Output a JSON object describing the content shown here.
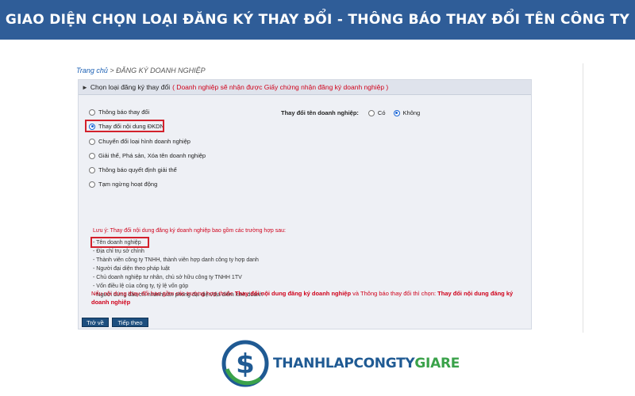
{
  "banner": {
    "title": "GIAO DIỆN CHỌN LOẠI ĐĂNG KÝ THAY ĐỔI - THÔNG BÁO THAY ĐỔI TÊN CÔNG TY"
  },
  "breadcrumb": {
    "home": "Trang chủ",
    "separator": ">",
    "current": "ĐĂNG KÝ DOANH NGHIỆP"
  },
  "panel": {
    "title": "Chọn loại đăng ký thay đổi",
    "note": "( Doanh nghiệp sẽ nhận được Giấy chứng nhận đăng ký doanh nghiệp )"
  },
  "options": [
    {
      "label": "Thông báo thay đổi",
      "selected": false
    },
    {
      "label": "Thay đổi nội dung ĐKDN",
      "selected": true
    },
    {
      "label": "Chuyển đổi loại hình doanh nghiệp",
      "selected": false
    },
    {
      "label": "Giải thể, Phá sản, Xóa tên doanh nghiệp",
      "selected": false
    },
    {
      "label": "Thông báo quyết định giải thể",
      "selected": false
    },
    {
      "label": "Tạm ngừng hoạt động",
      "selected": false
    }
  ],
  "name_change": {
    "question": "Thay đổi tên doanh nghiệp:",
    "yes_label": "Có",
    "no_label": "Không",
    "selected": "Không"
  },
  "info": {
    "heading": "Lưu ý: Thay đổi nội dung đăng ký doanh nghiệp bao gồm các trường hợp sau:",
    "items": [
      "- Tên doanh nghiệp",
      "- Địa chỉ trụ sở chính",
      "- Thành viên công ty TNHH, thành viên hợp danh công ty hợp danh",
      "- Người đại diện theo pháp luật",
      "- Chủ doanh nghiệp tư nhân, chủ sở hữu công ty TNHH 1TV",
      "- Vốn điều lệ của công ty, tỷ lệ vốn góp",
      "- Người đứng đầu chi nhánh/văn phòng đại diện/địa điểm kinh doanh"
    ]
  },
  "bottom_note": {
    "text_1": "Nếu nội dung thay đổi bao gồm các trường hợp thuộc ",
    "bold_1": "Thay đổi nội dung đăng ký doanh nghiệp",
    "text_2": " và Thông báo thay đổi thì chọn: ",
    "bold_2": "Thay đổi nội dung đăng ký doanh nghiệp"
  },
  "buttons": {
    "back": "Trở về",
    "next": "Tiếp theo"
  },
  "logo": {
    "text_primary": "THANHLAPCONGTY",
    "text_accent": "GIARE",
    "symbol": "$"
  },
  "colors": {
    "banner_bg": "#2f5d98",
    "highlight_red": "#d3212c",
    "note_red": "#d0021b",
    "button_bg": "#1d4f7f",
    "logo_blue": "#1f5a93",
    "logo_green": "#3aa24a"
  }
}
